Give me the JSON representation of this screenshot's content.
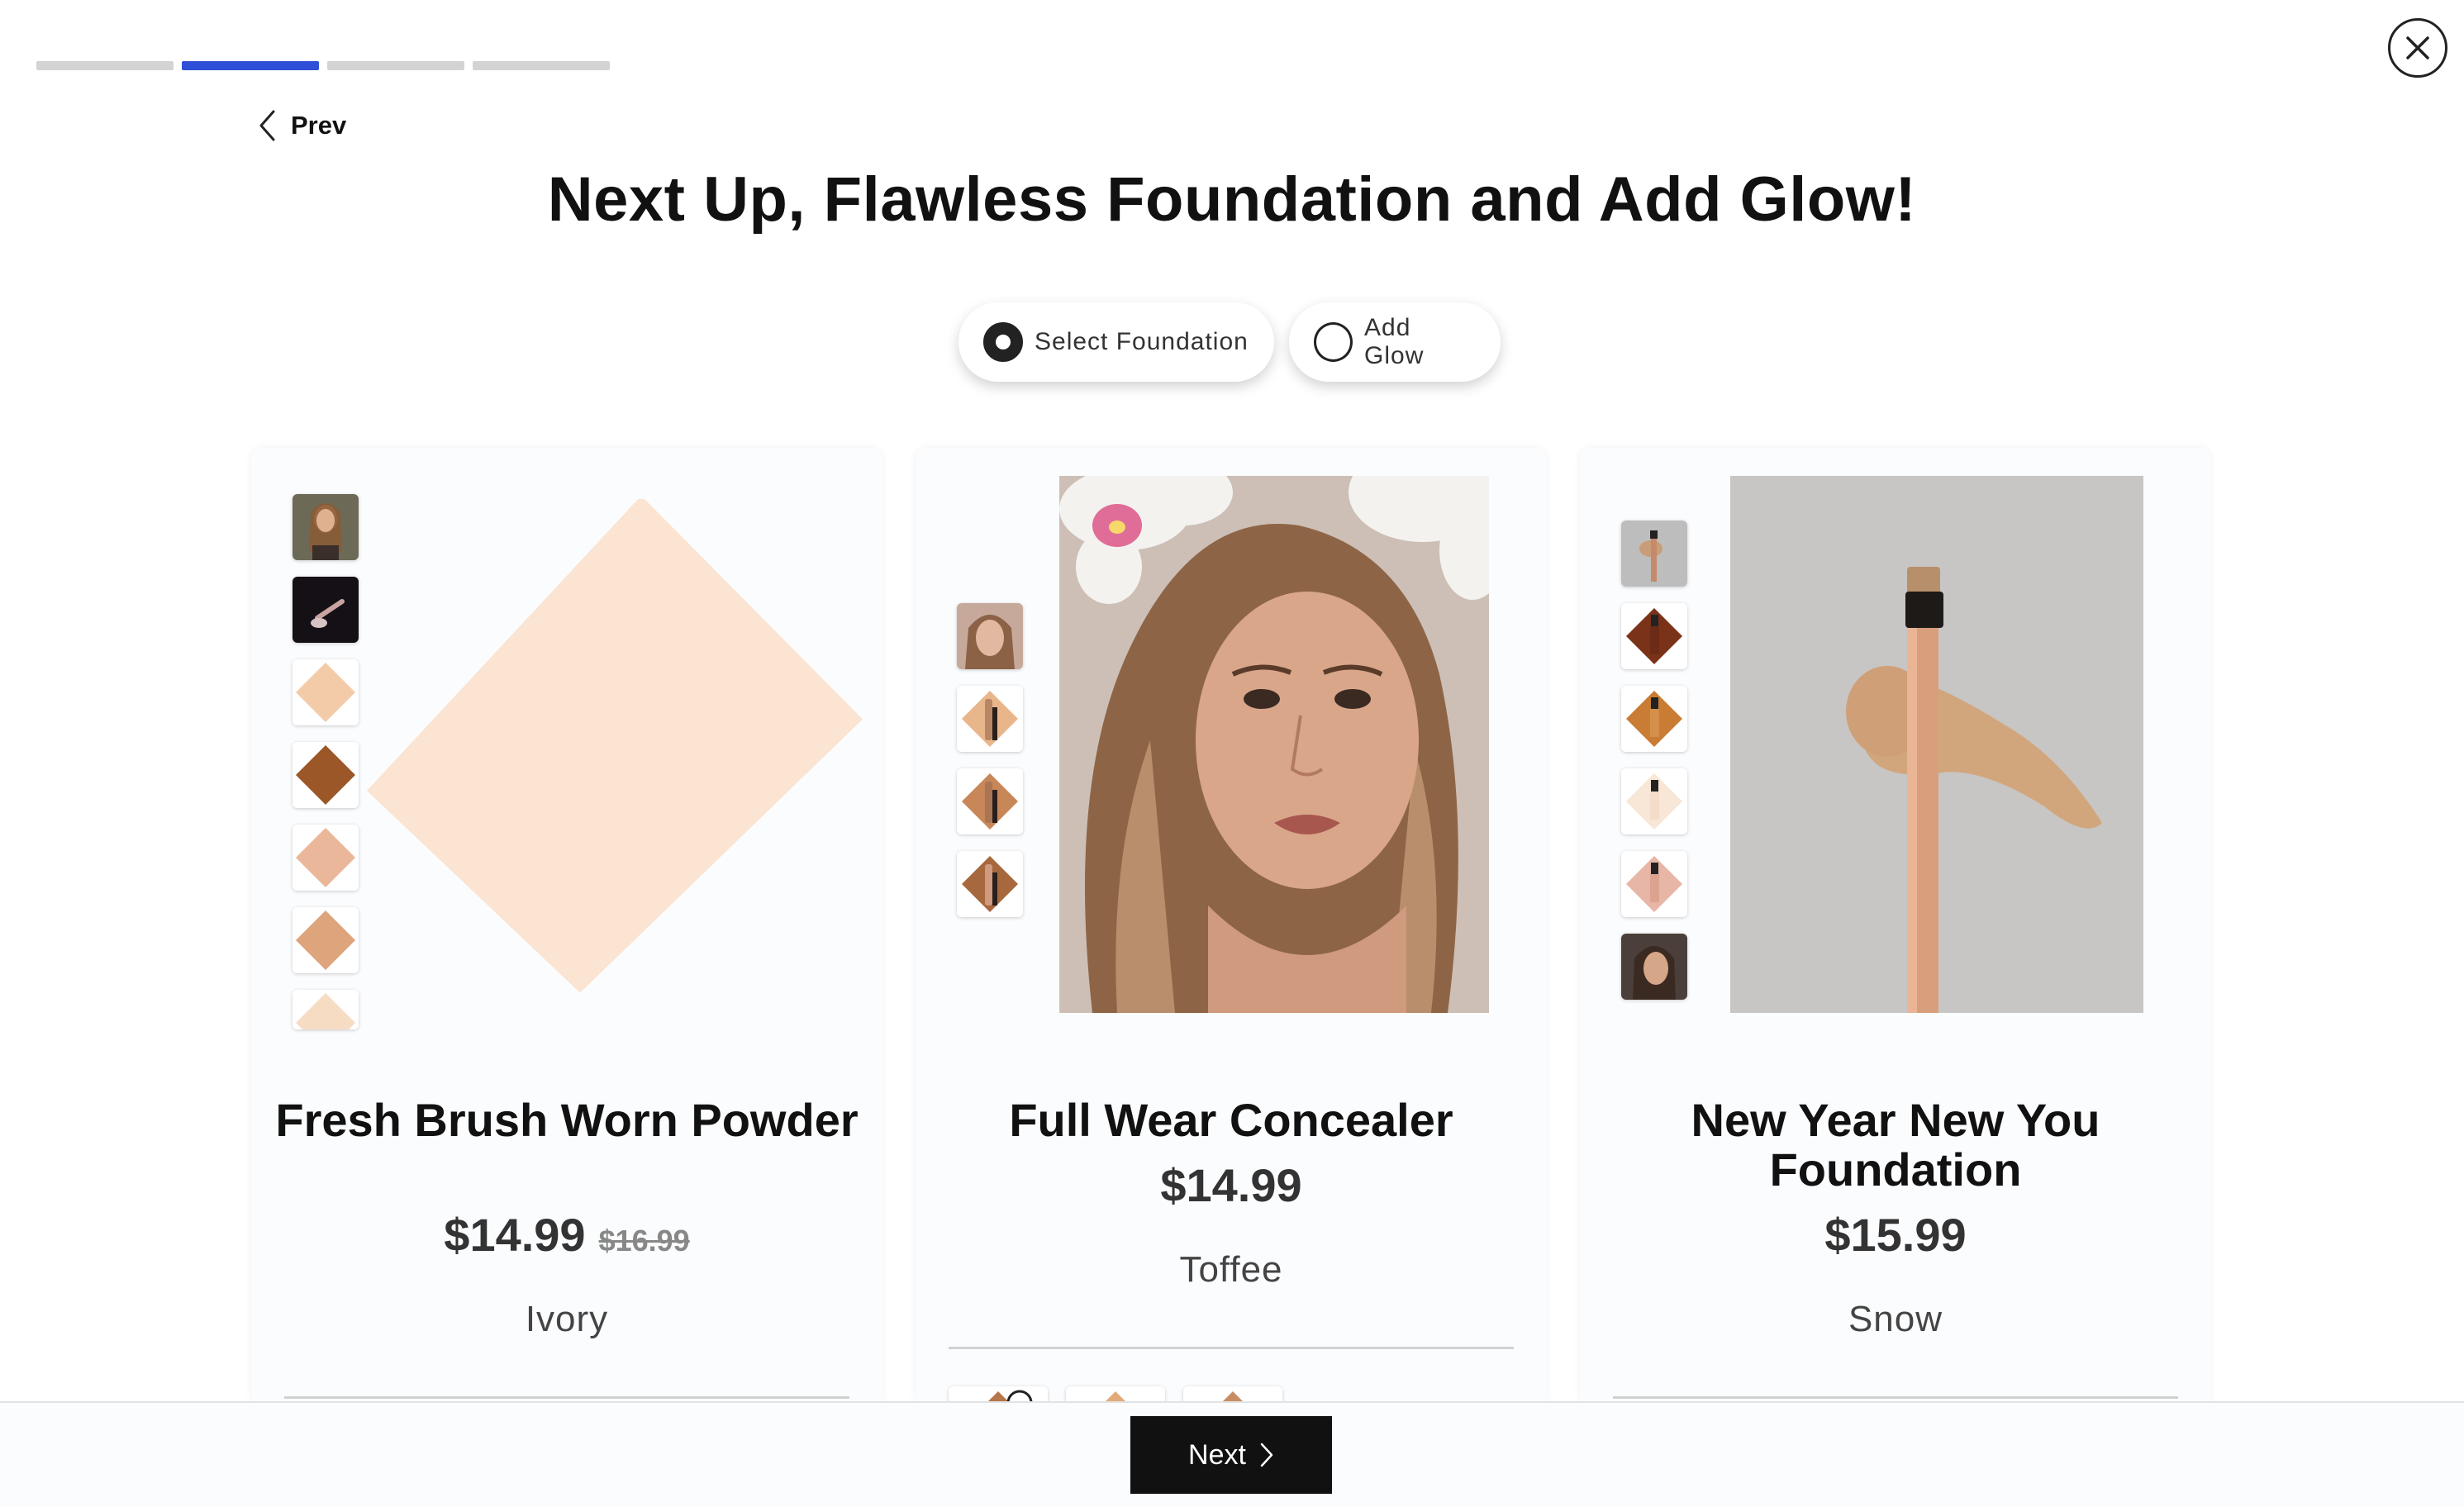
{
  "progress": {
    "total_steps": 4,
    "current_step": 2
  },
  "nav": {
    "prev_label": "Prev",
    "next_label": "Next"
  },
  "page_title": "Next Up, Flawless Foundation and Add Glow!",
  "toggles": [
    {
      "label": "Select Foundation",
      "selected": true
    },
    {
      "label": "Add Glow",
      "selected": false
    }
  ],
  "products": [
    {
      "name": "Fresh Brush Worn Powder",
      "price": "$14.99",
      "original_price": "$16.99",
      "shade": "Ivory",
      "main_image": "ivory-swatch-diamond",
      "thumbnails": [
        "model-photo",
        "brush-photo",
        "swatch-light-peach",
        "swatch-brown",
        "swatch-peach",
        "swatch-tan",
        "swatch-light"
      ]
    },
    {
      "name": "Full Wear Concealer",
      "price": "$14.99",
      "shade": "Toffee",
      "main_image": "model-portrait-flowers",
      "thumbnails": [
        "model-photo",
        "concealer-tube",
        "concealer-tube-dark",
        "concealer-tube-brown"
      ]
    },
    {
      "name": "New Year New You Foundation",
      "price": "$15.99",
      "shade": "Snow",
      "main_image": "foundation-brush-stroke",
      "thumbnails": [
        "brush-photo",
        "bottle-dark",
        "bottle-tan",
        "bottle-ivory",
        "bottle-pink",
        "model-photo"
      ]
    }
  ],
  "colors": {
    "accent": "#2f4fd8",
    "progress_inactive": "#d3d3d3",
    "swatch_ivory": "#fbe4d2",
    "button_bg": "#111111"
  }
}
